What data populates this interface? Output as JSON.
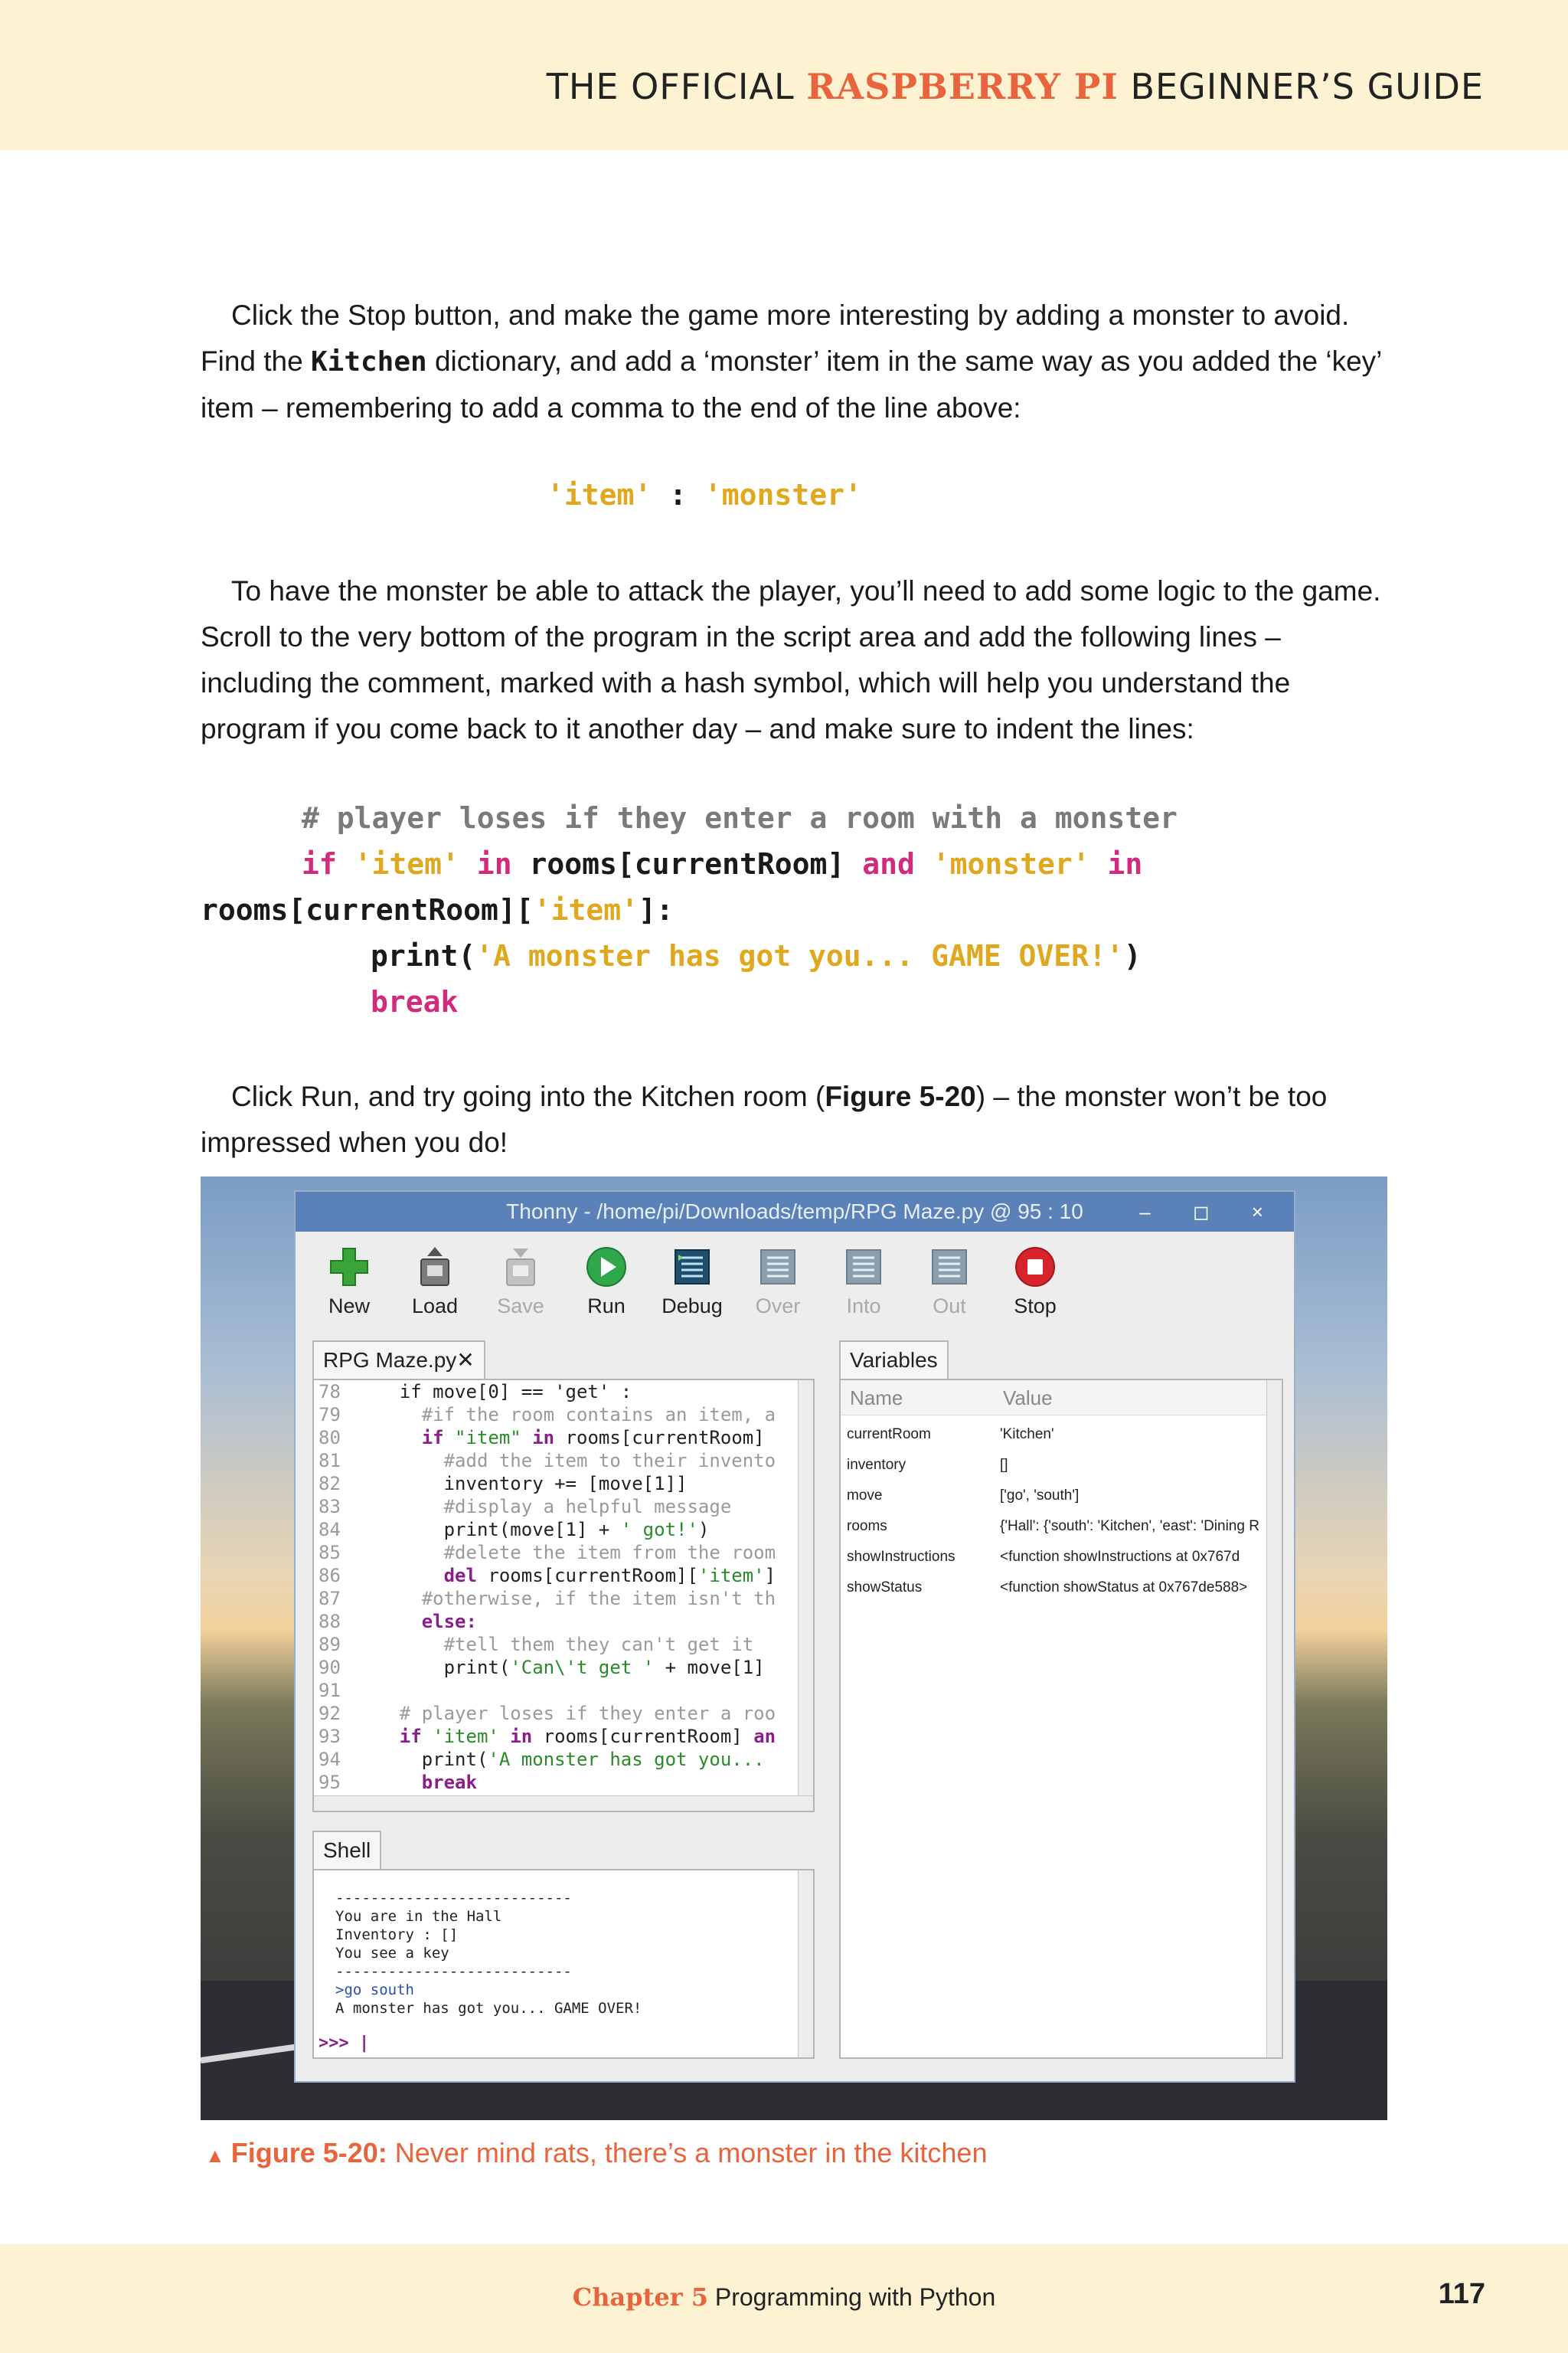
{
  "header": {
    "title_prefix": "THE OFFICIAL ",
    "title_brand": "RASPBERRY PI",
    "title_suffix": " BEGINNER’S GUIDE"
  },
  "para1": {
    "text1": "Click the Stop button, and make the game more interesting by adding a monster to avoid. Find the ",
    "code": "Kitchen",
    "text2": " dictionary, and add a ‘monster’ item in the same way as you added the ‘key’ item – remembering to add a comma to the end of the line above:"
  },
  "code1": {
    "left": "'item'",
    "sep": " : ",
    "right": "'monster'"
  },
  "para2": {
    "text": "To have the monster be able to attack the player, you’ll need to add some logic to the game. Scroll to the very bottom of the program in the script area and add the following lines – including the comment, marked with a hash symbol, which will help you understand the program if you come back to it another day – and make sure to indent the lines:"
  },
  "code2": {
    "comment": "# player loses if they enter a room with a monster",
    "if_kw": "if",
    "item_str": "'item'",
    "in_kw": "in",
    "rooms_expr": "rooms[currentRoom]",
    "and_kw": "and",
    "monster_str": "'monster'",
    "in_kw2": "in",
    "line2_a": "rooms[currentRoom][",
    "line2_str": "'item'",
    "line2_b": "]:",
    "print_a": "print(",
    "print_str": "'A monster has got you... GAME OVER!'",
    "print_b": ")",
    "break_kw": "break"
  },
  "para3": {
    "text1": "Click Run, and try going into the Kitchen room (",
    "fig_ref": "Figure 5-20",
    "text2": ") – the monster won’t be too impressed when you do!"
  },
  "screenshot": {
    "window_title": "Thonny  -  /home/pi/Downloads/temp/RPG Maze.py  @  95 : 10",
    "window_controls": "– ◻ ×",
    "toolbar": [
      {
        "label": "New",
        "icon": "plus-icon",
        "enabled": true
      },
      {
        "label": "Load",
        "icon": "load-icon",
        "enabled": true
      },
      {
        "label": "Save",
        "icon": "save-icon",
        "enabled": false
      },
      {
        "label": "Run",
        "icon": "run-icon",
        "enabled": true
      },
      {
        "label": "Debug",
        "icon": "debug-icon",
        "enabled": true
      },
      {
        "label": "Over",
        "icon": "step-over-icon",
        "enabled": false
      },
      {
        "label": "Into",
        "icon": "step-into-icon",
        "enabled": false
      },
      {
        "label": "Out",
        "icon": "step-out-icon",
        "enabled": false
      },
      {
        "label": "Stop",
        "icon": "stop-icon",
        "enabled": true
      }
    ],
    "editor_tab": "RPG Maze.py",
    "editor_tab_close": "✕",
    "variables_tab": "Variables",
    "variables_header": {
      "name": "Name",
      "value": "Value"
    },
    "variables": [
      {
        "name": "currentRoom",
        "value": "'Kitchen'"
      },
      {
        "name": "inventory",
        "value": "[]"
      },
      {
        "name": "move",
        "value": "['go', 'south']"
      },
      {
        "name": "rooms",
        "value": "{'Hall': {'south': 'Kitchen', 'east': 'Dining R"
      },
      {
        "name": "showInstructions",
        "value": "<function showInstructions at 0x767d"
      },
      {
        "name": "showStatus",
        "value": "<function showStatus at 0x767de588>"
      }
    ],
    "shell_tab": "Shell",
    "shell_lines": [
      "---------------------------",
      "You are in the Hall",
      "Inventory : []",
      "You see a key",
      "---------------------------",
      ">go south",
      "A monster has got you... GAME OVER!"
    ],
    "shell_prompt": ">>> |"
  },
  "caption": {
    "label": "Figure 5-20:",
    "text": " Never mind rats, there’s a monster in the kitchen"
  },
  "footer": {
    "chapter_label": "Chapter 5",
    "chapter_title": " Programming with Python",
    "page_number": "117"
  }
}
